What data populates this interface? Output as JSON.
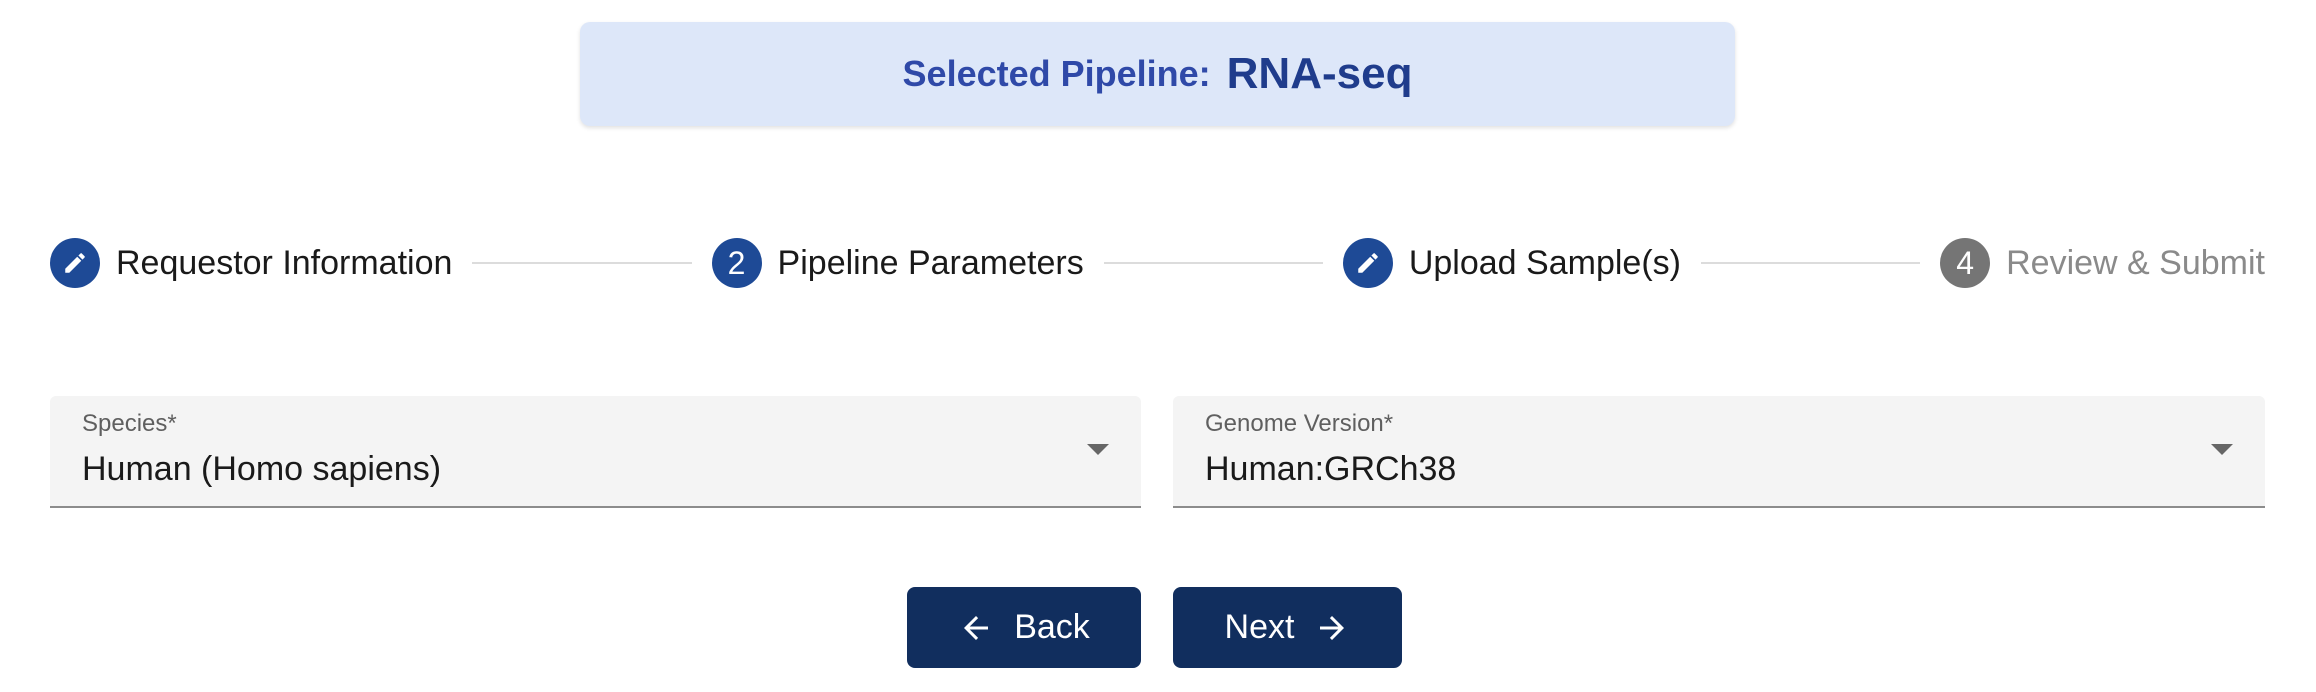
{
  "banner": {
    "label": "Selected Pipeline:",
    "value": "RNA-seq"
  },
  "stepper": {
    "steps": [
      {
        "label": "Requestor Information",
        "icon": "pencil-icon",
        "state": "active"
      },
      {
        "label": "Pipeline Parameters",
        "number": "2",
        "state": "active"
      },
      {
        "label": "Upload Sample(s)",
        "icon": "pencil-icon",
        "state": "active"
      },
      {
        "label": "Review & Submit",
        "number": "4",
        "state": "inactive"
      }
    ]
  },
  "form": {
    "species": {
      "label": "Species*",
      "value": "Human (Homo sapiens)"
    },
    "genome_version": {
      "label": "Genome Version*",
      "value": "Human:GRCh38"
    }
  },
  "actions": {
    "back_label": "Back",
    "next_label": "Next"
  },
  "colors": {
    "primary": "#112e5e",
    "step_active": "#1e4a96",
    "step_inactive": "#757575",
    "banner_bg": "#dde7f9"
  }
}
